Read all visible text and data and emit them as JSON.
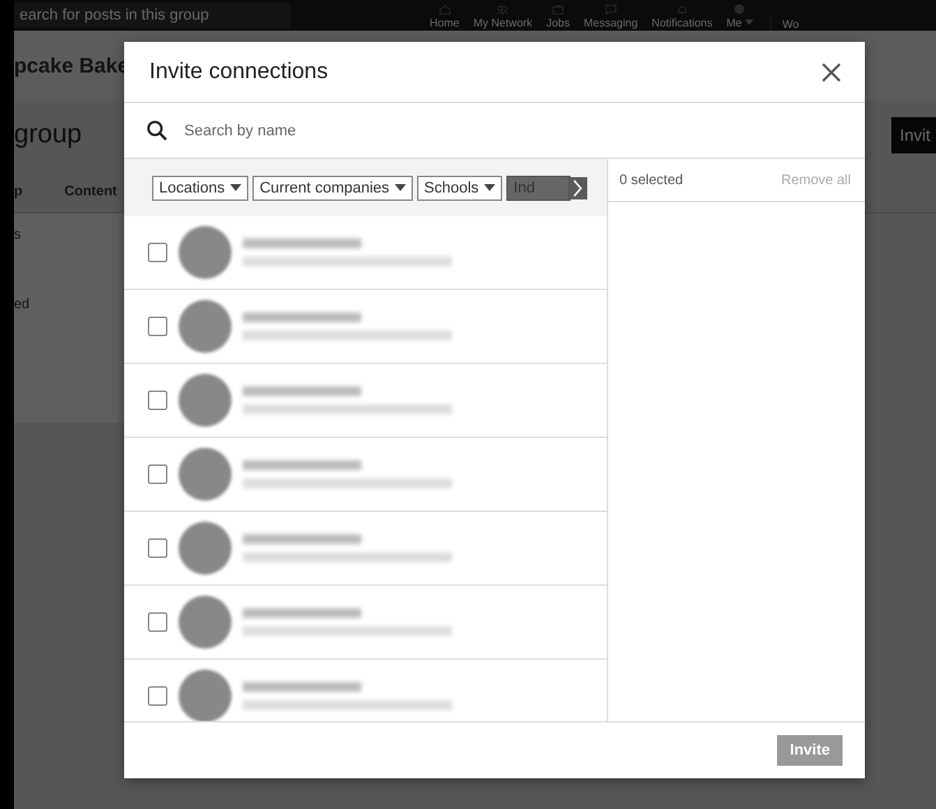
{
  "background_page": {
    "search_placeholder": "earch for posts in this group",
    "nav": [
      {
        "label": "Home",
        "kind": "home"
      },
      {
        "label": "My Network",
        "kind": "network"
      },
      {
        "label": "Jobs",
        "kind": "jobs"
      },
      {
        "label": "Messaging",
        "kind": "messaging"
      },
      {
        "label": "Notifications",
        "kind": "bell"
      },
      {
        "label": "Me",
        "kind": "me"
      }
    ],
    "work_label": "Wo",
    "group_name": "pcake Bake",
    "heading": "group",
    "invite_button": "Invit",
    "tabs": [
      {
        "label": "p"
      },
      {
        "label": "Content"
      }
    ],
    "side_texts": [
      "s",
      "ed"
    ]
  },
  "dialog": {
    "title": "Invite connections",
    "search": {
      "placeholder": "Search by name"
    },
    "filters": [
      {
        "label": "Locations",
        "cut": false
      },
      {
        "label": "Current companies",
        "cut": false
      },
      {
        "label": "Schools",
        "cut": false
      },
      {
        "label": "Ind",
        "cut": true
      }
    ],
    "contacts": [
      {
        "checked": false
      },
      {
        "checked": false
      },
      {
        "checked": false
      },
      {
        "checked": false
      },
      {
        "checked": false
      },
      {
        "checked": false
      },
      {
        "checked": false
      }
    ],
    "selected_count": "0 selected",
    "remove_all": "Remove all",
    "invite_button": {
      "label": "Invite",
      "disabled": true
    }
  }
}
